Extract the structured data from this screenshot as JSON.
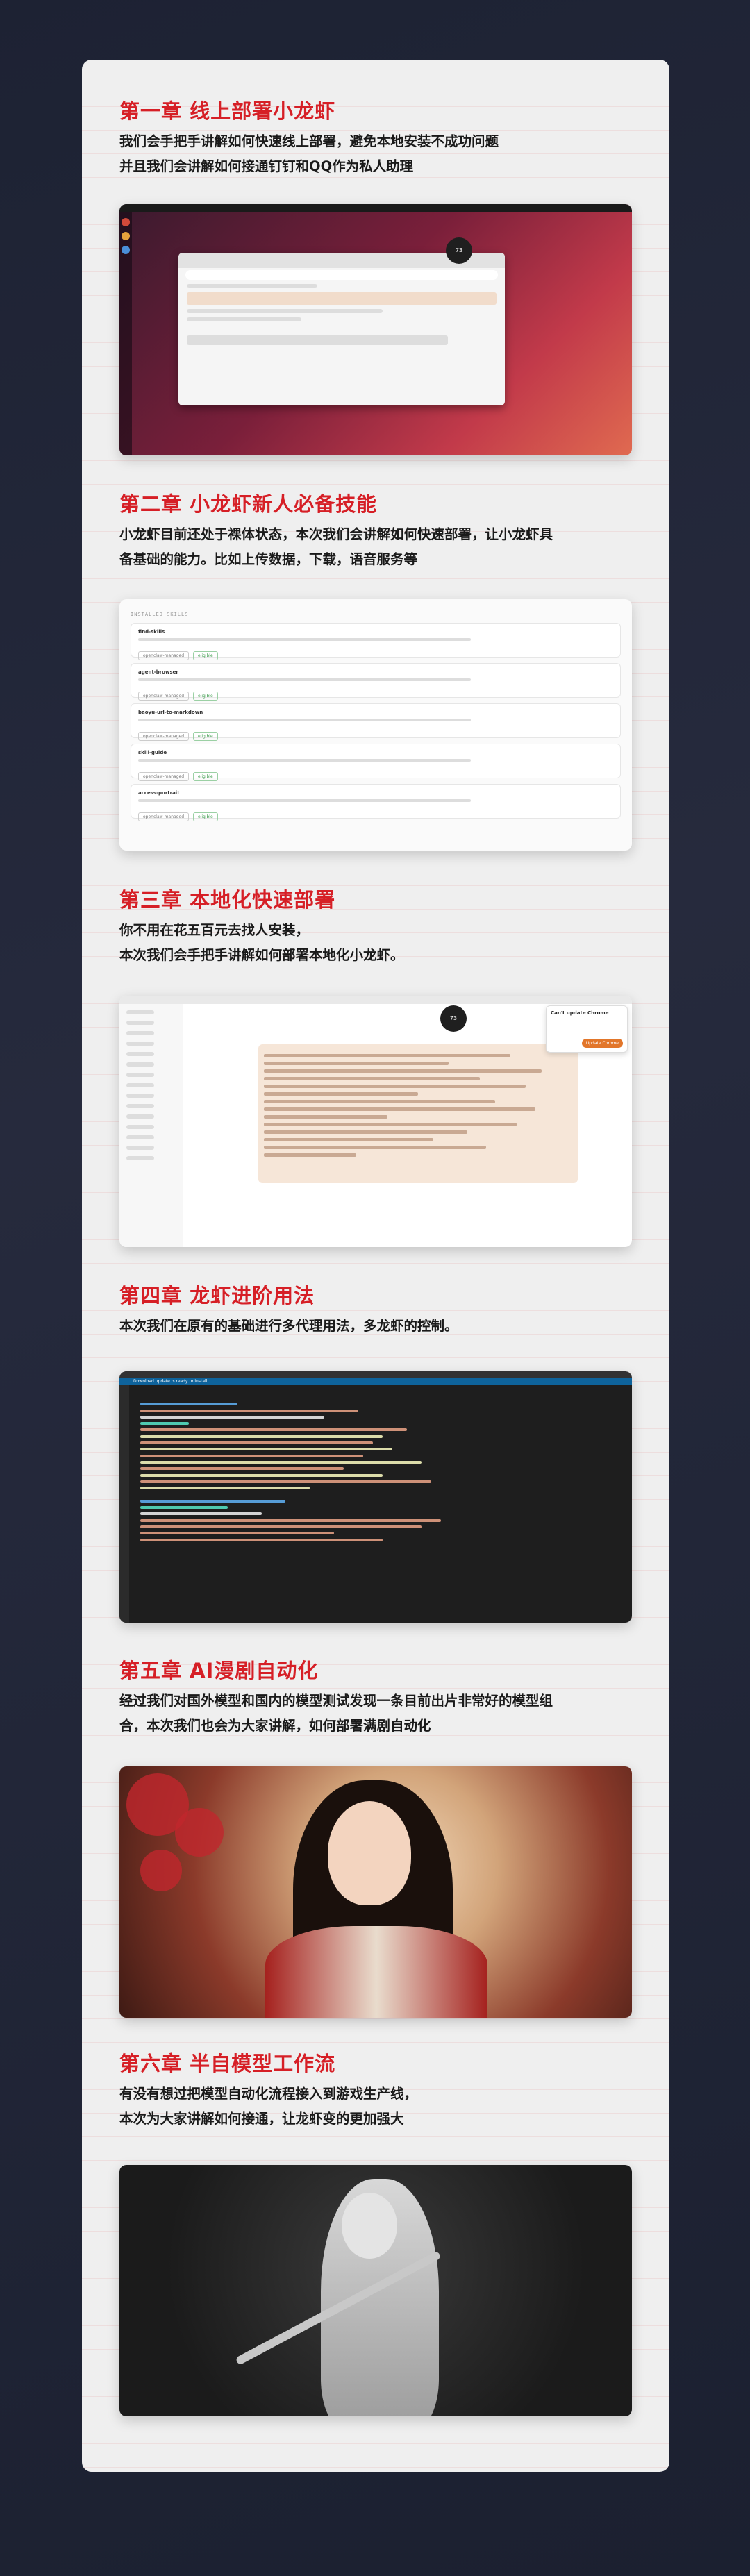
{
  "chapters": [
    {
      "title": "第一章 线上部署小龙虾",
      "desc": [
        "我们会手把手讲解如何快速线上部署，避免本地安装不成功问题",
        "并且我们会讲解如何接通钉钉和QQ作为私人助理"
      ]
    },
    {
      "title": "第二章 小龙虾新人必备技能",
      "desc": [
        "小龙虾目前还处于裸体状态，本次我们会讲解如何快速部署，让小龙虾具",
        "备基础的能力。比如上传数据，下载，语音服务等"
      ]
    },
    {
      "title": "第三章 本地化快速部署",
      "desc": [
        "你不用在花五百元去找人安装，",
        "本次我们会手把手讲解如何部署本地化小龙虾。"
      ]
    },
    {
      "title": "第四章 龙虾进阶用法",
      "desc": [
        "本次我们在原有的基础进行多代理用法，多龙虾的控制。"
      ]
    },
    {
      "title": "第五章 AI漫剧自动化",
      "desc": [
        "经过我们对国外模型和国内的模型测试发现一条目前出片非常好的模型组",
        "合，本次我们也会为大家讲解，如何部署满剧自动化"
      ]
    },
    {
      "title": "第六章 半自模型工作流",
      "desc": [
        "有没有想过把模型自动化流程接入到游戏生产线，",
        "本次为大家讲解如何接通，让龙虾变的更加强大"
      ]
    }
  ],
  "screens": {
    "s1_bubble": "73",
    "s2_header": "INSTALLED SKILLS",
    "s2_skills": [
      "find-skills",
      "agent-browser",
      "baoyu-url-to-markdown",
      "skill-guide",
      "access-portrait"
    ],
    "s2_tag_a": "openclaw-managed",
    "s2_tag_b": "eligible",
    "s3_popup_title": "Can't update Chrome",
    "s3_popup_btn": "Update Chrome",
    "s4_banner": "Download update is ready to install"
  }
}
